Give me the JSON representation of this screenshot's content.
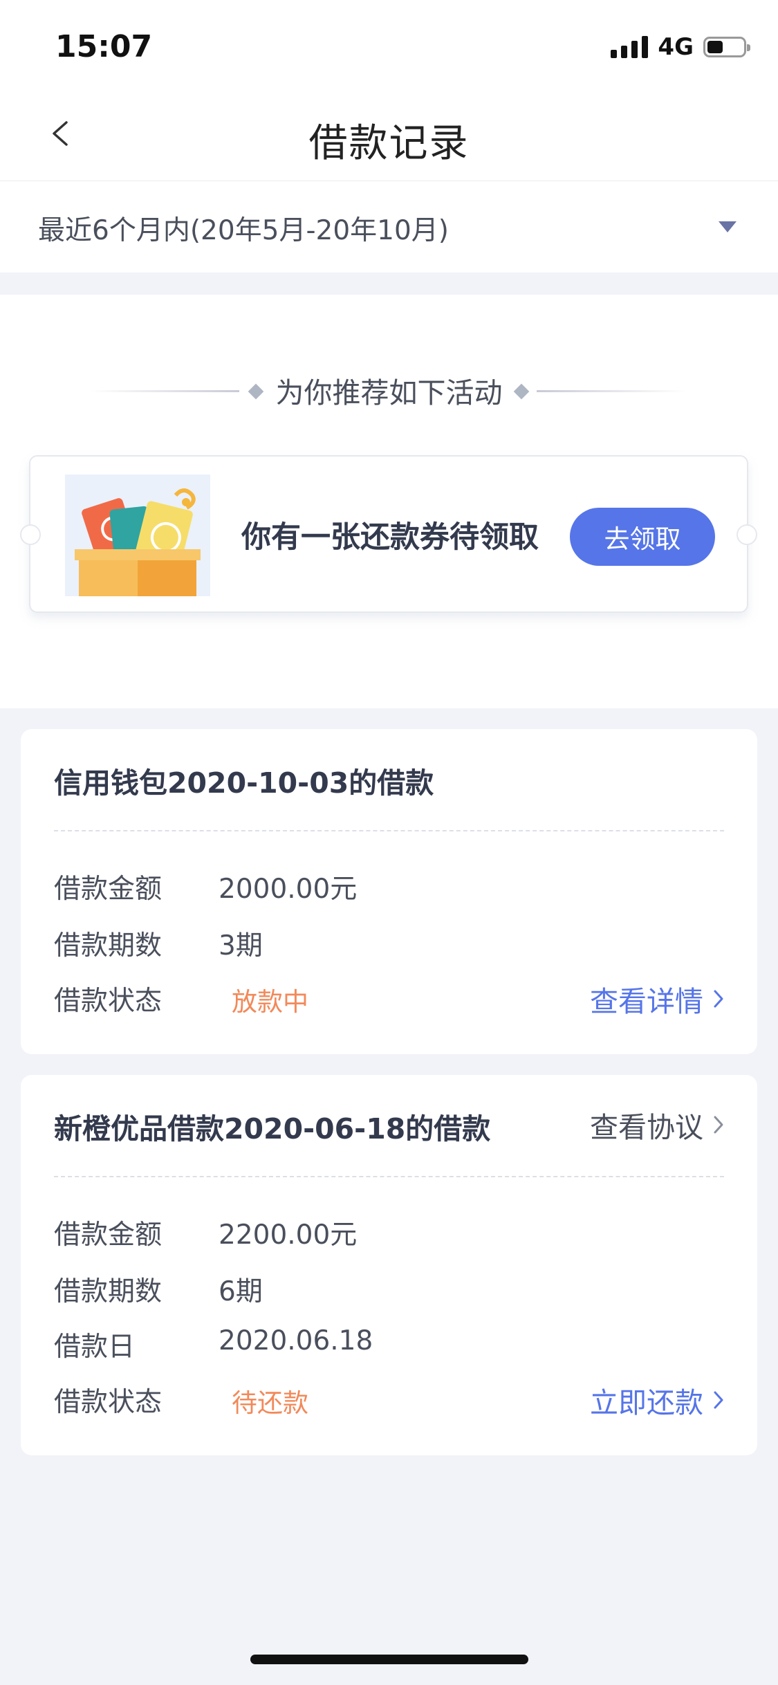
{
  "status_bar": {
    "time": "15:07",
    "network": "4G"
  },
  "nav": {
    "title": "借款记录",
    "back_icon": "chevron-left-icon"
  },
  "filter": {
    "label": "最近6个月内(20年5月-20年10月)",
    "icon": "triangle-down-icon"
  },
  "promo": {
    "heading": "为你推荐如下活动",
    "coupon_text": "你有一张还款券待领取",
    "claim_button": "去领取",
    "image_icon": "gift-box-coupon-icon"
  },
  "loans": [
    {
      "title": "信用钱包2020-10-03的借款",
      "rows": [
        {
          "label": "借款金额",
          "value": "2000.00元"
        },
        {
          "label": "借款期数",
          "value": "3期"
        }
      ],
      "status_label": "借款状态",
      "status": "放款中",
      "action": "查看详情"
    },
    {
      "title": "新橙优品借款2020-06-18的借款",
      "header_action": "查看协议",
      "rows": [
        {
          "label": "借款金额",
          "value": "2200.00元"
        },
        {
          "label": "借款期数",
          "value": "6期"
        },
        {
          "label": "借款日",
          "value": "2020.06.18"
        }
      ],
      "status_label": "借款状态",
      "status": "待还款",
      "action": "立即还款"
    }
  ],
  "colors": {
    "accent": "#5675e8",
    "status_orange": "#f2895a",
    "background": "#f2f3f8"
  }
}
